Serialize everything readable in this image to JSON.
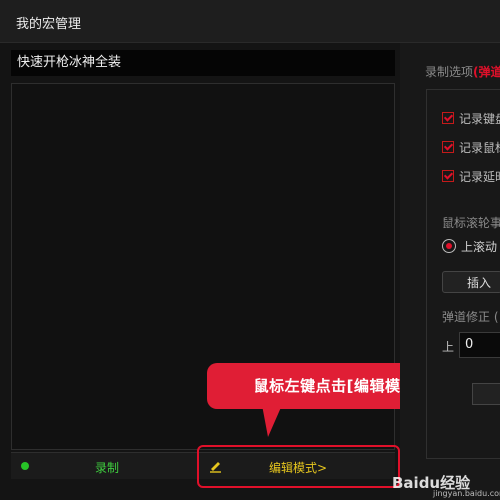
{
  "window": {
    "title": "我的宏管理"
  },
  "macro": {
    "name": "快速开枪冰神全装"
  },
  "bottom_bar": {
    "record_label": "录制",
    "edit_mode_label": "编辑模式>"
  },
  "annotation": {
    "callout_text": "鼠标左键点击[编辑模式]"
  },
  "options": {
    "header_prefix": "录制选项",
    "header_accent": "(弹道",
    "checkboxes": [
      "记录键盘",
      "记录鼠标",
      "记录延时"
    ],
    "scroll_label": "鼠标滚轮事",
    "radio_label": "上滚动",
    "insert_label": "插入",
    "correction_label": "弹道修正 (",
    "up_label": "上",
    "up_value": "0"
  },
  "watermark": {
    "text": "Baidu经验",
    "sub": "jingyan.baidu.com"
  },
  "colors": {
    "accent_red": "#e0102a",
    "record_green": "#3fcf3f",
    "edit_yellow": "#e6c61e"
  }
}
